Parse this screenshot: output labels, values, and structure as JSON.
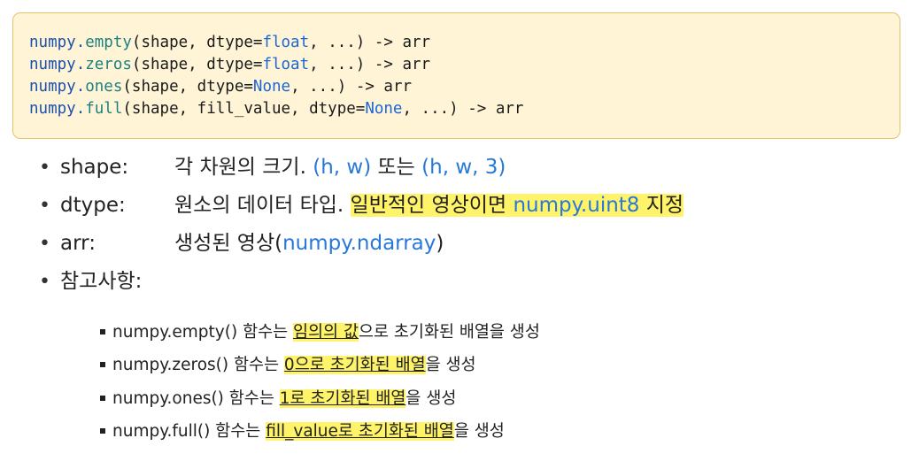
{
  "code_lines": [
    {
      "mod": "numpy",
      "dot": ".",
      "fn": "empty",
      "a1": "(shape, dtype=",
      "kw": "float",
      "a2": ", ...) -> arr"
    },
    {
      "mod": "numpy",
      "dot": ".",
      "fn": "zeros",
      "a1": "(shape, dtype=",
      "kw": "float",
      "a2": ", ...) -> arr"
    },
    {
      "mod": "numpy",
      "dot": ".",
      "fn": "ones",
      "a1": "(shape, dtype=",
      "kw": "None",
      "a2": ", ...) -> arr"
    },
    {
      "mod": "numpy",
      "dot": ".",
      "fn": "full",
      "a1": "(shape, fill_value, dtype=",
      "kw": "None",
      "a2": ", ...) -> arr"
    }
  ],
  "bullet_glyph": "•",
  "subbullet_glyph": "■",
  "params": [
    {
      "name": "shape:",
      "t1": "각 차원의 크기. ",
      "b1": "(h, w)",
      "t2": " 또는 ",
      "b2": "(h, w, 3)"
    },
    {
      "name": "dtype:",
      "t1": "원소의 데이터 타입. ",
      "h1": "일반적인 영상이면 ",
      "hb": "numpy.uint8",
      "h2": " 지정"
    },
    {
      "name": "arr:",
      "t1": "생성된 영상(",
      "b1": "numpy.ndarray",
      "t2": ")"
    },
    {
      "name": "참고사항:"
    }
  ],
  "notes": [
    {
      "pre": "numpy.empty() 함수는 ",
      "hl": "임의의 값",
      "post": "으로 초기화된 배열을 생성"
    },
    {
      "pre": "numpy.zeros() 함수는 ",
      "hl": "0으로 초기화된 배열",
      "post": "을 생성"
    },
    {
      "pre": "numpy.ones() 함수는 ",
      "hl": "1로 초기화된 배열",
      "post": "을 생성"
    },
    {
      "pre": "numpy.full() 함수는 ",
      "hl": "fill_value로 초기화된 배열",
      "post": "을 생성"
    }
  ],
  "colors": {
    "code_bg": "#fff5d6",
    "code_border": "#e4c26a",
    "highlight": "#fff36a",
    "link_blue": "#2878d8"
  }
}
